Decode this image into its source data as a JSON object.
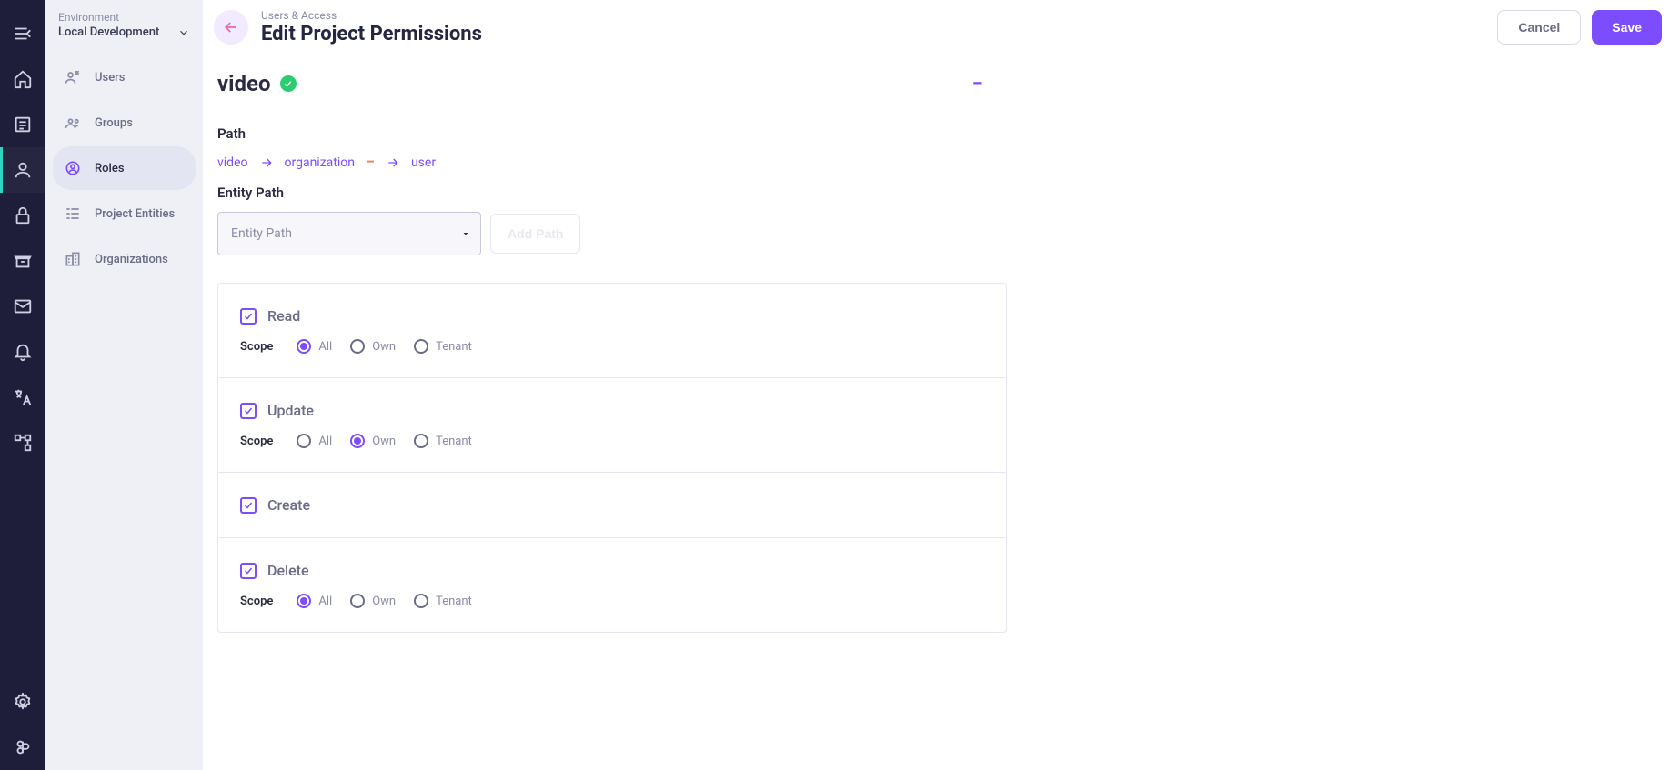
{
  "env": {
    "label": "Environment",
    "value": "Local Development"
  },
  "sidebar": {
    "items": [
      {
        "label": "Users"
      },
      {
        "label": "Groups"
      },
      {
        "label": "Roles"
      },
      {
        "label": "Project Entities"
      },
      {
        "label": "Organizations"
      }
    ]
  },
  "header": {
    "breadcrumb": "Users & Access",
    "title": "Edit Project Permissions",
    "cancel": "Cancel",
    "save": "Save"
  },
  "entity": {
    "name": "video",
    "verified": true
  },
  "path": {
    "heading": "Path",
    "chain": [
      "video",
      "organization",
      "user"
    ]
  },
  "entityPath": {
    "heading": "Entity Path",
    "placeholder": "Entity Path",
    "addLabel": "Add Path"
  },
  "scope": {
    "label": "Scope",
    "options": [
      "All",
      "Own",
      "Tenant"
    ]
  },
  "permissions": [
    {
      "name": "Read",
      "checked": true,
      "scope": "All",
      "showScope": true
    },
    {
      "name": "Update",
      "checked": true,
      "scope": "Own",
      "showScope": true
    },
    {
      "name": "Create",
      "checked": true,
      "scope": null,
      "showScope": false
    },
    {
      "name": "Delete",
      "checked": true,
      "scope": "All",
      "showScope": true
    }
  ]
}
